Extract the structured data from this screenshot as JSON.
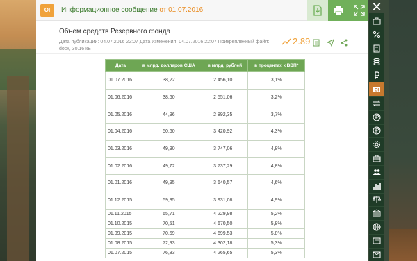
{
  "topbar": {
    "badge": "OI",
    "title": "Информационное сообщение",
    "date": "от 01.07.2016",
    "buttons": [
      "download",
      "print",
      "fullscreen"
    ]
  },
  "document": {
    "title": "Объем средств Резервного фонда",
    "meta_line1": "Дата публикации:   04.07.2016 22:07    Дата изменения:   04.07.2016 22:07    Прикрепленный файл:",
    "meta_line2": "docx, 30.16 кБ",
    "rate": "2.89"
  },
  "table": {
    "headers": [
      "Дата",
      "в млрд. долларов США",
      "в млрд. рублей",
      "в процентах к ВВП*"
    ],
    "rows": [
      [
        "01.07.2016",
        "38,22",
        "2 456,10",
        "3,1%"
      ],
      [
        "01.06.2016",
        "38,60",
        "2 551,06",
        "3,2%"
      ],
      [
        "01.05.2016",
        "44,96",
        "2 892,35",
        "3,7%"
      ],
      [
        "01.04.2016",
        "50,60",
        "3 420,92",
        "4,3%"
      ],
      [
        "01.03.2016",
        "49,90",
        "3 747,06",
        "4,8%"
      ],
      [
        "01.02.2016",
        "49,72",
        "3 737,29",
        "4,8%"
      ],
      [
        "01.01.2016",
        "49,95",
        "3 640,57",
        "4,6%"
      ],
      [
        "01.12.2015",
        "59,35",
        "3 931,08",
        "4,9%"
      ],
      [
        "01.11.2015",
        "65,71",
        "4 229,98",
        "5,2%"
      ],
      [
        "01.10.2015",
        "70,51",
        "4 670,50",
        "5,8%"
      ],
      [
        "01.09.2015",
        "70,69",
        "4 699,53",
        "5,8%"
      ],
      [
        "01.08.2015",
        "72,93",
        "4 302,18",
        "5,3%"
      ],
      [
        "01.07.2015",
        "76,83",
        "4 265,65",
        "5,3%"
      ]
    ]
  },
  "close_label": "✕",
  "rail": {
    "icons": [
      "briefcase-icon",
      "percent-icon",
      "calculator-icon",
      "coins-icon",
      "ruble-icon",
      "info-badge-icon",
      "transfer-icon",
      "ruble-circle-icon",
      "ruble-coin-icon",
      "gear-icon",
      "briefcase2-icon",
      "people-icon",
      "bar-chart-icon",
      "scales-icon",
      "bank-icon",
      "globe-icon",
      "document-icon",
      "envelope-icon"
    ],
    "active_index": 5
  },
  "colors": {
    "accent_green": "#70b05a",
    "table_header": "#6ea654",
    "accent_orange": "#f0a23b",
    "rail": "#1f3b27"
  }
}
